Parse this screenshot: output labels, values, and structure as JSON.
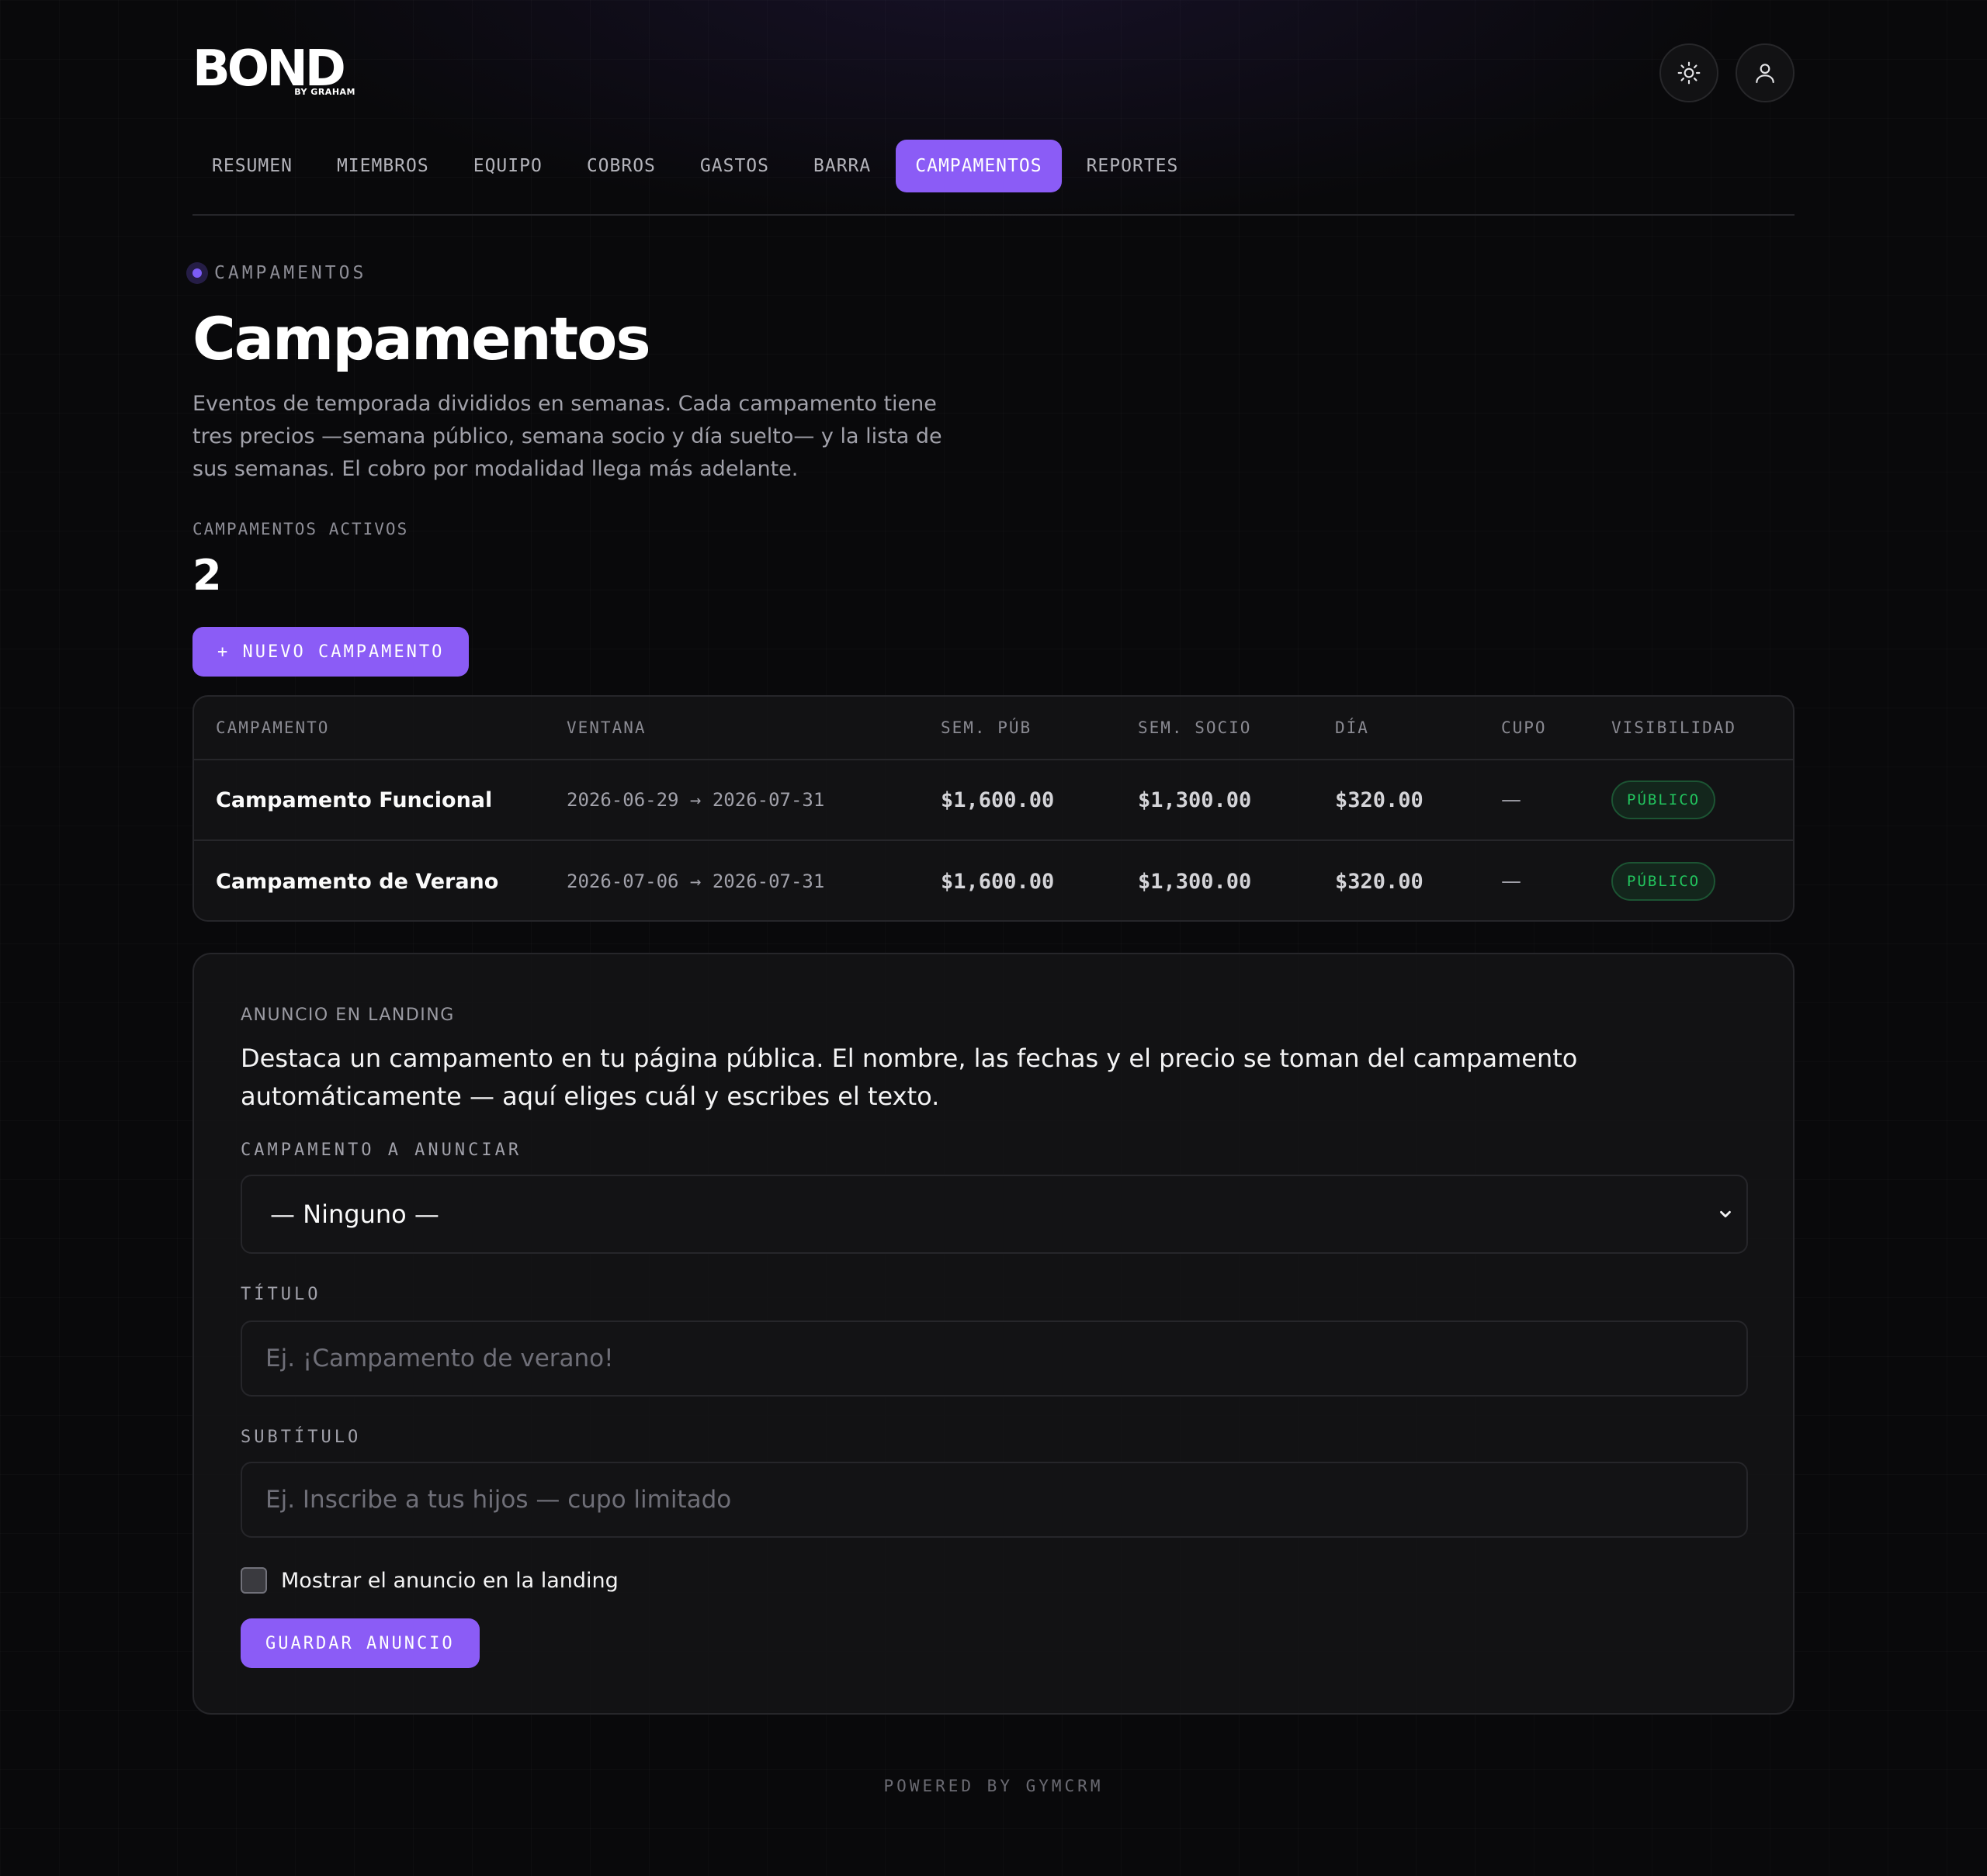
{
  "brand": {
    "name": "BOND",
    "sub": "BY GRAHAM"
  },
  "header": {
    "theme_icon": "sun-icon",
    "user_icon": "user-icon"
  },
  "tabs": [
    {
      "label": "RESUMEN",
      "active": false
    },
    {
      "label": "MIEMBROS",
      "active": false
    },
    {
      "label": "EQUIPO",
      "active": false
    },
    {
      "label": "COBROS",
      "active": false
    },
    {
      "label": "GASTOS",
      "active": false
    },
    {
      "label": "BARRA",
      "active": false
    },
    {
      "label": "CAMPAMENTOS",
      "active": true
    },
    {
      "label": "REPORTES",
      "active": false
    }
  ],
  "page": {
    "eyebrow": "CAMPAMENTOS",
    "title": "Campamentos",
    "description": "Eventos de temporada divididos en semanas. Cada campamento tiene tres precios —semana público, semana socio y día suelto— y la lista de sus semanas. El cobro por modalidad llega más adelante.",
    "stat_label": "CAMPAMENTOS ACTIVOS",
    "stat_value": "2",
    "new_button": "+ NUEVO CAMPAMENTO"
  },
  "table": {
    "headers": [
      "CAMPAMENTO",
      "VENTANA",
      "SEM. PÚB",
      "SEM. SOCIO",
      "DÍA",
      "CUPO",
      "VISIBILIDAD"
    ],
    "rows": [
      {
        "name": "Campamento Funcional",
        "window": "2026-06-29 → 2026-07-31",
        "week_public": "$1,600.00",
        "week_member": "$1,300.00",
        "day": "$320.00",
        "capacity": "—",
        "visibility": "PÚBLICO"
      },
      {
        "name": "Campamento de Verano",
        "window": "2026-07-06 → 2026-07-31",
        "week_public": "$1,600.00",
        "week_member": "$1,300.00",
        "day": "$320.00",
        "capacity": "—",
        "visibility": "PÚBLICO"
      }
    ]
  },
  "announcement": {
    "eyebrow": "ANUNCIO EN LANDING",
    "description": "Destaca un campamento en tu página pública. El nombre, las fechas y el precio se toman del campamento automáticamente — aquí eliges cuál y escribes el texto.",
    "select_label": "CAMPAMENTO A ANUNCIAR",
    "select_value": "— Ninguno —",
    "title_label": "TÍTULO",
    "title_placeholder": "Ej. ¡Campamento de verano!",
    "subtitle_label": "SUBTÍTULO",
    "subtitle_placeholder": "Ej. Inscribe a tus hijos — cupo limitado",
    "checkbox_label": "Mostrar el anuncio en la landing",
    "checkbox_checked": false,
    "save_button": "GUARDAR ANUNCIO"
  },
  "footer": {
    "text": "POWERED BY GYMCRM"
  },
  "colors": {
    "accent": "#8b5cf6",
    "success": "#22c55e",
    "background": "#09090b"
  }
}
